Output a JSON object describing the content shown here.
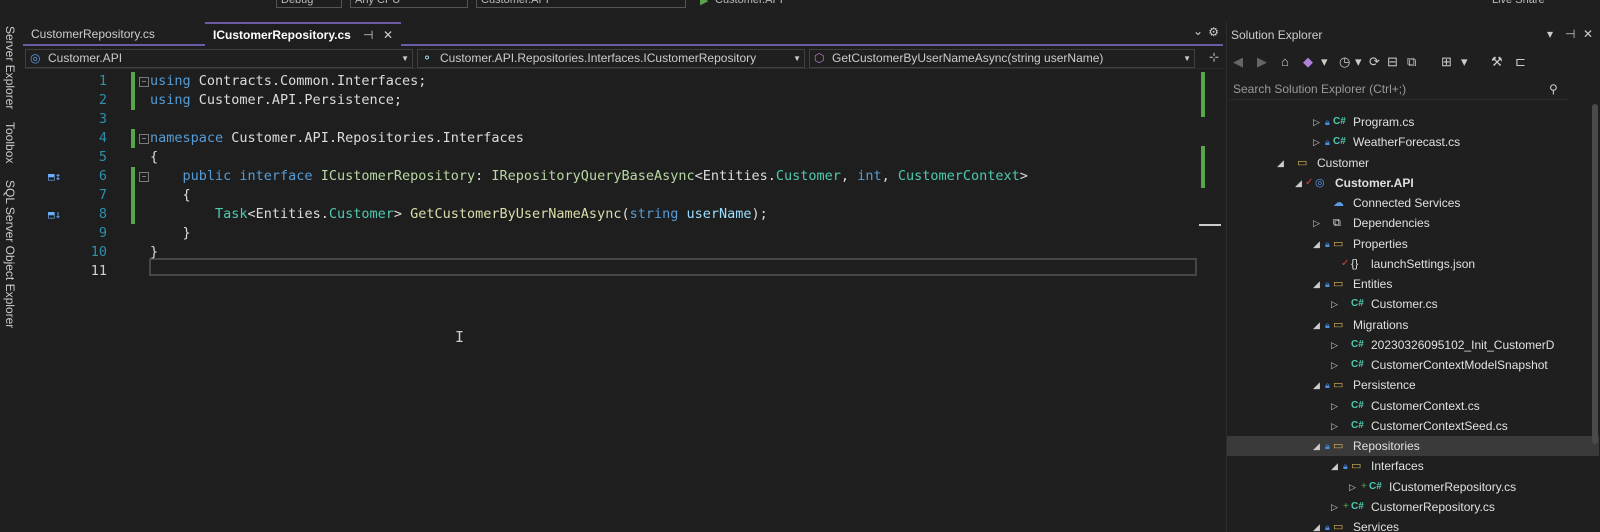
{
  "toolbar": {
    "config": "Debug",
    "platform": "Any CPU",
    "startup_project": "Customer.API",
    "run_target": "Customer.API",
    "live_share": "Live Share"
  },
  "left_strip": {
    "tabs": [
      "Server Explorer",
      "Toolbox",
      "SQL Server Object Explorer"
    ]
  },
  "editor": {
    "tabs": [
      {
        "label": "CustomerRepository.cs",
        "active": false
      },
      {
        "label": "ICustomerRepository.cs",
        "active": true,
        "pin_icon": "pin-icon",
        "close_icon": "close-icon"
      }
    ],
    "nav": {
      "project": "Customer.API",
      "type": "Customer.API.Repositories.Interfaces.ICustomerRepository",
      "member": "GetCustomerByUserNameAsync(string userName)"
    },
    "lines": [
      {
        "n": "1",
        "t": [
          [
            "kw",
            "using"
          ],
          [
            "p",
            " Contracts.Common.Interfaces;"
          ]
        ]
      },
      {
        "n": "2",
        "t": [
          [
            "kw",
            "using"
          ],
          [
            "p",
            " Customer.API.Persistence;"
          ]
        ]
      },
      {
        "n": "3",
        "t": []
      },
      {
        "n": "4",
        "t": [
          [
            "kw",
            "namespace"
          ],
          [
            "p",
            " Customer.API.Repositories.Interfaces"
          ]
        ]
      },
      {
        "n": "5",
        "t": [
          [
            "p",
            "{"
          ]
        ]
      },
      {
        "n": "6",
        "t": [
          [
            "p",
            "    "
          ],
          [
            "kw",
            "public interface"
          ],
          [
            "p",
            " "
          ],
          [
            "in",
            "ICustomerRepository"
          ],
          [
            "p",
            ": "
          ],
          [
            "in",
            "IRepositoryQueryBaseAsync"
          ],
          [
            "p",
            "<Entities."
          ],
          [
            "ty",
            "Customer"
          ],
          [
            "p",
            ", "
          ],
          [
            "kw",
            "int"
          ],
          [
            "p",
            ", "
          ],
          [
            "ty",
            "CustomerContext"
          ],
          [
            "p",
            ">"
          ]
        ]
      },
      {
        "n": "7",
        "t": [
          [
            "p",
            "    {"
          ]
        ]
      },
      {
        "n": "8",
        "t": [
          [
            "p",
            "        "
          ],
          [
            "ty",
            "Task"
          ],
          [
            "p",
            "<Entities."
          ],
          [
            "ty",
            "Customer"
          ],
          [
            "p",
            "> "
          ],
          [
            "mt",
            "GetCustomerByUserNameAsync"
          ],
          [
            "p",
            "("
          ],
          [
            "kw",
            "string"
          ],
          [
            "p",
            " "
          ],
          [
            "pm",
            "userName"
          ],
          [
            "p",
            ");"
          ]
        ]
      },
      {
        "n": "9",
        "t": [
          [
            "p",
            "    }"
          ]
        ]
      },
      {
        "n": "10",
        "t": [
          [
            "p",
            "}"
          ]
        ]
      },
      {
        "n": "11",
        "t": []
      }
    ]
  },
  "solution_explorer": {
    "title": "Solution Explorer",
    "search_placeholder": "Search Solution Explorer (Ctrl+;)",
    "items": [
      {
        "label": "Program.cs",
        "icon": "csharp-file-icon"
      },
      {
        "label": "WeatherForecast.cs",
        "icon": "csharp-file-icon"
      },
      {
        "label": "Customer",
        "icon": "folder-icon"
      },
      {
        "label": "Customer.API",
        "icon": "project-icon"
      },
      {
        "label": "Connected Services",
        "icon": "connected-services-icon"
      },
      {
        "label": "Dependencies",
        "icon": "dependencies-icon"
      },
      {
        "label": "Properties",
        "icon": "properties-folder-icon"
      },
      {
        "label": "launchSettings.json",
        "icon": "json-file-icon"
      },
      {
        "label": "Entities",
        "icon": "folder-icon"
      },
      {
        "label": "Customer.cs",
        "icon": "csharp-file-icon"
      },
      {
        "label": "Migrations",
        "icon": "folder-icon"
      },
      {
        "label": "20230326095102_Init_CustomerD",
        "icon": "csharp-file-icon"
      },
      {
        "label": "CustomerContextModelSnapshot",
        "icon": "csharp-file-icon"
      },
      {
        "label": "Persistence",
        "icon": "folder-icon"
      },
      {
        "label": "CustomerContext.cs",
        "icon": "csharp-file-icon"
      },
      {
        "label": "CustomerContextSeed.cs",
        "icon": "csharp-file-icon"
      },
      {
        "label": "Repositories",
        "icon": "folder-icon"
      },
      {
        "label": "Interfaces",
        "icon": "folder-icon"
      },
      {
        "label": "ICustomerRepository.cs",
        "icon": "csharp-file-icon"
      },
      {
        "label": "CustomerRepository.cs",
        "icon": "csharp-file-icon"
      },
      {
        "label": "Services",
        "icon": "folder-icon"
      }
    ]
  }
}
